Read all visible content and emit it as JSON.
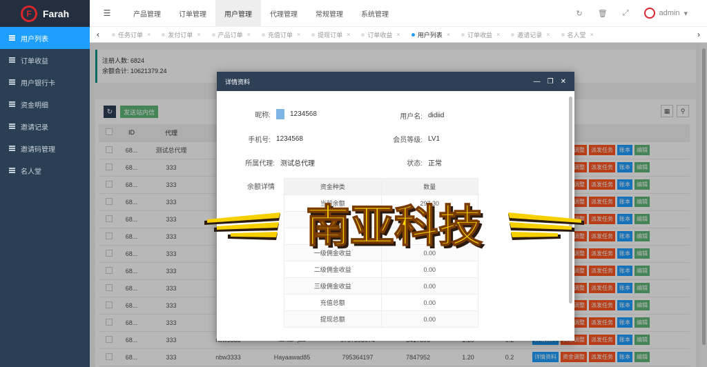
{
  "brand": {
    "name": "Farah",
    "mark": "F"
  },
  "sidebar": {
    "items": [
      {
        "label": "用户列表",
        "active": true
      },
      {
        "label": "订单收益"
      },
      {
        "label": "用户银行卡"
      },
      {
        "label": "资金明细"
      },
      {
        "label": "邀请记录"
      },
      {
        "label": "邀请码管理"
      },
      {
        "label": "名人堂"
      }
    ]
  },
  "header": {
    "nav": [
      "产品管理",
      "订单管理",
      "用户管理",
      "代理管理",
      "常规管理",
      "系统管理"
    ],
    "active_nav": "用户管理",
    "user": "admin"
  },
  "tabs": [
    "任务订单",
    "发付订单",
    "产品订单",
    "充值订单",
    "提现订单",
    "订单收益",
    "用户列表",
    "订单收益",
    "邀请记录",
    "名人堂"
  ],
  "active_tab": "用户列表",
  "stats": {
    "registered_label": "注册人数: 6824",
    "balance_label": "余额合计: 10621379.24"
  },
  "toolbar": {
    "send_label": "发送站内信"
  },
  "table": {
    "headers": [
      "ID",
      "代理",
      "",
      "",
      "",
      "",
      "",
      "",
      "操作"
    ],
    "rows": [
      {
        "id": "68...",
        "agent": "测试总代理",
        "c3": "",
        "c4": "",
        "c5": "",
        "c6": "",
        "c7": "",
        "c8": "",
        "detail": false
      },
      {
        "id": "68...",
        "agent": "333",
        "c3": "",
        "c4": "",
        "c5": "",
        "c6": "",
        "c7": "",
        "c8": "",
        "detail": false
      },
      {
        "id": "68...",
        "agent": "333",
        "c3": "",
        "c4": "",
        "c5": "",
        "c6": "",
        "c7": "",
        "c8": "",
        "detail": false
      },
      {
        "id": "68...",
        "agent": "333",
        "c3": "",
        "c4": "",
        "c5": "",
        "c6": "",
        "c7": "",
        "c8": "",
        "detail": false
      },
      {
        "id": "68...",
        "agent": "333",
        "c3": "",
        "c4": "",
        "c5": "",
        "c6": "",
        "c7": "",
        "c8": "",
        "detail": false
      },
      {
        "id": "68...",
        "agent": "333",
        "c3": "",
        "c4": "",
        "c5": "",
        "c6": "",
        "c7": "",
        "c8": "",
        "detail": false
      },
      {
        "id": "68...",
        "agent": "333",
        "c3": "",
        "c4": "",
        "c5": "",
        "c6": "",
        "c7": "",
        "c8": "",
        "detail": false
      },
      {
        "id": "68...",
        "agent": "333",
        "c3": "",
        "c4": "",
        "c5": "",
        "c6": "",
        "c7": "",
        "c8": "",
        "detail": false
      },
      {
        "id": "68...",
        "agent": "333",
        "c3": "",
        "c4": "",
        "c5": "",
        "c6": "",
        "c7": "",
        "c8": "",
        "detail": false
      },
      {
        "id": "68...",
        "agent": "333",
        "c3": "",
        "c4": "",
        "c5": "",
        "c6": "",
        "c7": "",
        "c8": "",
        "detail": false
      },
      {
        "id": "68...",
        "agent": "333",
        "c3": "",
        "c4": "",
        "c5": "",
        "c6": "",
        "c7": "",
        "c8": "",
        "detail": false
      },
      {
        "id": "68...",
        "agent": "333",
        "c3": "nbw3333",
        "c4": "نغم عبدالله",
        "c5": "0797393074",
        "c6": "3417896",
        "c7": "1.20",
        "c8": "0.2",
        "detail": true
      },
      {
        "id": "68...",
        "agent": "333",
        "c3": "nbw3333",
        "c4": "Hayaawad85",
        "c5": "795364197",
        "c6": "7847952",
        "c7": "1.20",
        "c8": "0.2",
        "detail": true
      }
    ],
    "ops": {
      "detail": "详情资料",
      "fund": "资金调整",
      "task": "派发任务",
      "account": "账本",
      "edit": "编辑"
    }
  },
  "modal": {
    "title": "详情资料",
    "nickname_label": "昵称:",
    "nickname": "1234568",
    "username_label": "用户名:",
    "username": "didiid",
    "phone_label": "手机号:",
    "phone": "1234568",
    "level_label": "会员等级:",
    "level": "LV1",
    "agent_label": "所属代理:",
    "agent": "测试总代理",
    "status_label": "状态:",
    "status": "正常",
    "balance_label": "余额详情",
    "balance_headers": [
      "资金种类",
      "数量"
    ],
    "balance_rows": [
      {
        "type": "当前余额",
        "amount": "297.30"
      },
      {
        "type": "",
        "amount": ""
      },
      {
        "type": "",
        "amount": ""
      },
      {
        "type": "一级佣金收益",
        "amount": "0.00"
      },
      {
        "type": "二级佣金收益",
        "amount": "0.00"
      },
      {
        "type": "三级佣金收益",
        "amount": "0.00"
      },
      {
        "type": "充值总额",
        "amount": "0.00"
      },
      {
        "type": "提现总额",
        "amount": "0.00"
      }
    ]
  },
  "watermark": {
    "text": "南亚科技",
    "colors": {
      "fill": "#f7d000",
      "shadow": "#2b1a10",
      "stroke": "#7a3b00"
    }
  }
}
